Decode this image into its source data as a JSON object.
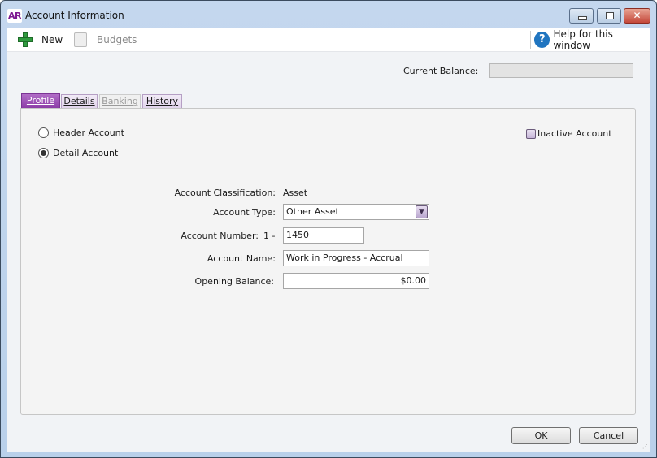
{
  "window": {
    "app_logo": "AR",
    "title": "Account Information",
    "controls": {
      "minimize": "minimize",
      "maximize": "maximize",
      "close": "✕"
    }
  },
  "toolbar": {
    "new_label": "New",
    "budgets_label": "Budgets",
    "help_label": "Help for this window",
    "help_icon": "?"
  },
  "header": {
    "current_balance_label": "Current Balance:",
    "current_balance_value": ""
  },
  "tabs": [
    {
      "label": "Profile",
      "state": "active"
    },
    {
      "label": "Details",
      "state": "normal"
    },
    {
      "label": "Banking",
      "state": "disabled"
    },
    {
      "label": "History",
      "state": "normal"
    }
  ],
  "profile": {
    "account_kind_options": [
      {
        "label": "Header Account",
        "checked": false
      },
      {
        "label": "Detail Account",
        "checked": true
      }
    ],
    "inactive_label": "Inactive Account",
    "inactive_checked": false,
    "classification_label": "Account Classification:",
    "classification_value": "Asset",
    "type_label": "Account Type:",
    "type_value": "Other Asset",
    "number_label": "Account Number:",
    "number_prefix": "1 -",
    "number_value": "1450",
    "name_label": "Account Name:",
    "name_value": "Work in Progress - Accrual",
    "opening_label": "Opening Balance:",
    "opening_value": "$0.00"
  },
  "footer": {
    "ok_label": "OK",
    "cancel_label": "Cancel"
  }
}
